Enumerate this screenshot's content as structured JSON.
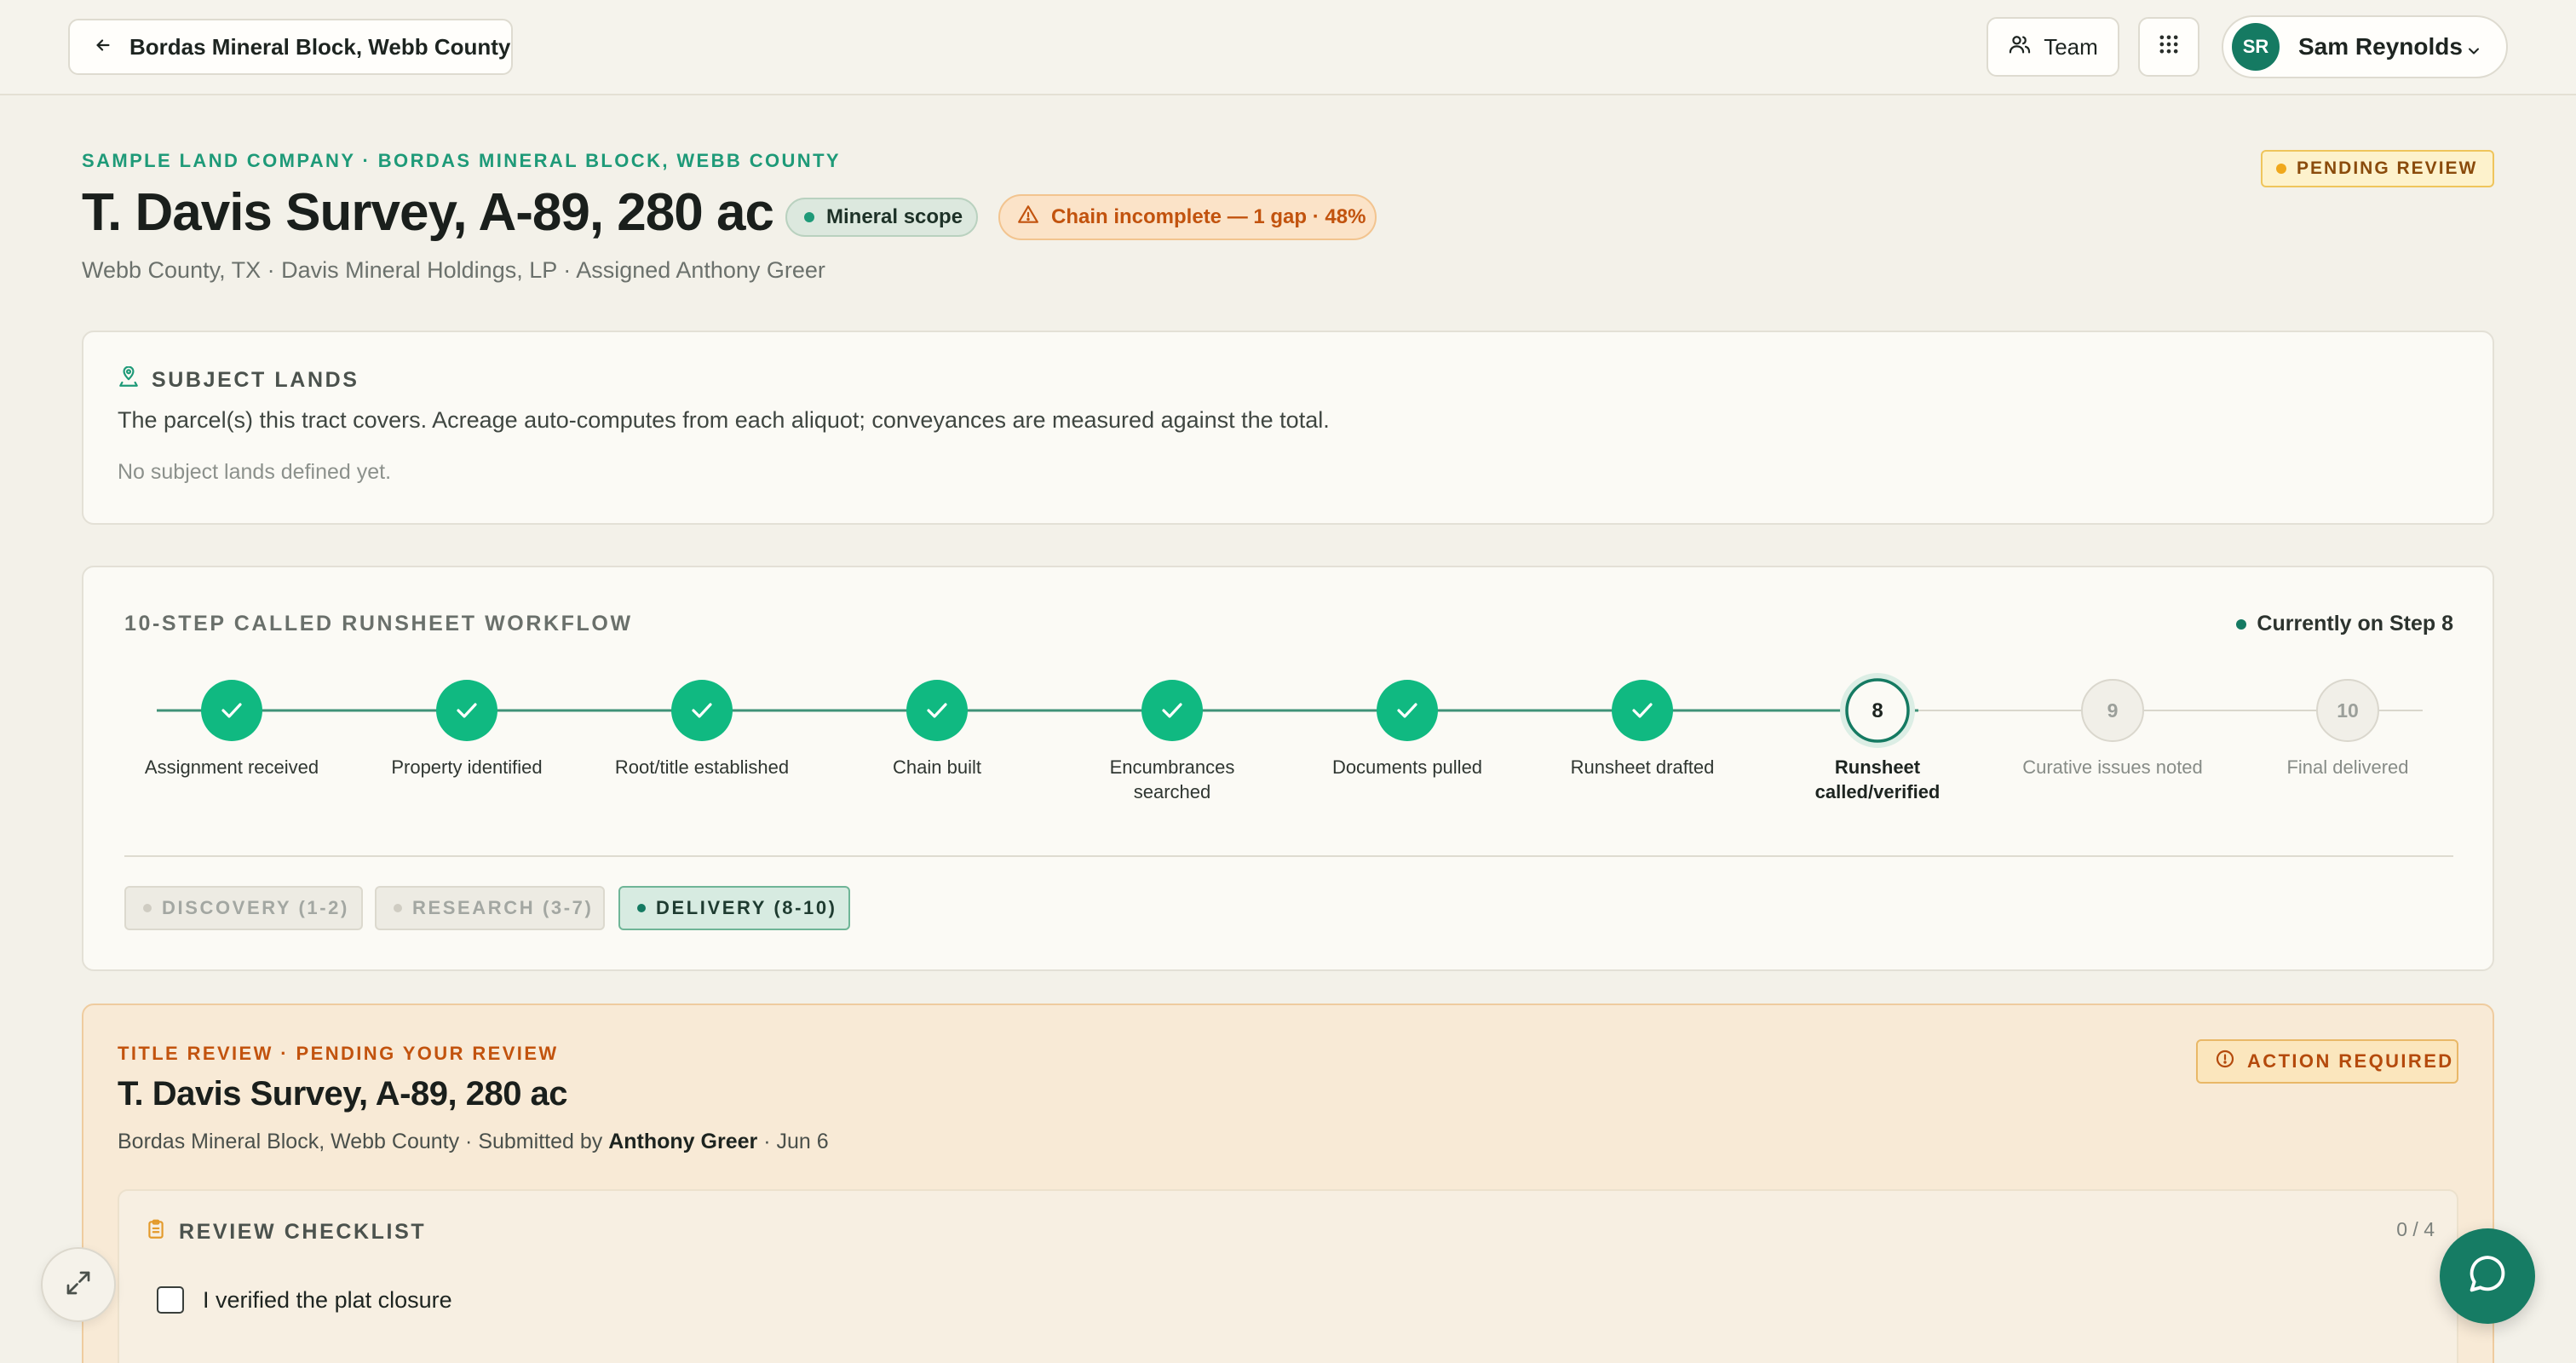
{
  "topbar": {
    "back_label": "Bordas Mineral Block, Webb County",
    "team_label": "Team",
    "user": {
      "initials": "SR",
      "name": "Sam Reynolds"
    }
  },
  "header": {
    "eyebrow": "SAMPLE LAND COMPANY · BORDAS MINERAL BLOCK, WEBB COUNTY",
    "title": "T. Davis Survey, A-89, 280 ac",
    "scope_badge": "Mineral scope",
    "chain_badge": "Chain incomplete — 1 gap · 48%",
    "subtitle": "Webb County, TX · Davis Mineral Holdings, LP · Assigned Anthony Greer",
    "status_badge": "PENDING REVIEW"
  },
  "subject_lands": {
    "heading": "SUBJECT LANDS",
    "description": "The parcel(s) this tract covers. Acreage auto-computes from each aliquot; conveyances are measured against the total.",
    "empty_text": "No subject lands defined yet."
  },
  "workflow": {
    "heading": "10-STEP CALLED RUNSHEET WORKFLOW",
    "current_text": "Currently on Step 8",
    "current_step": 8,
    "steps": [
      {
        "label": "Assignment received",
        "status": "done"
      },
      {
        "label": "Property identified",
        "status": "done"
      },
      {
        "label": "Root/title established",
        "status": "done"
      },
      {
        "label": "Chain built",
        "status": "done"
      },
      {
        "label": "Encumbrances searched",
        "status": "done"
      },
      {
        "label": "Documents pulled",
        "status": "done"
      },
      {
        "label": "Runsheet drafted",
        "status": "done"
      },
      {
        "label": "Runsheet called/verified",
        "status": "current"
      },
      {
        "label": "Curative issues noted",
        "status": "future"
      },
      {
        "label": "Final delivered",
        "status": "future"
      }
    ],
    "phases": [
      {
        "label": "DISCOVERY (1-2)",
        "active": false
      },
      {
        "label": "RESEARCH (3-7)",
        "active": false
      },
      {
        "label": "DELIVERY (8-10)",
        "active": true
      }
    ]
  },
  "review": {
    "eyebrow": "TITLE REVIEW · PENDING YOUR REVIEW",
    "title": "T. Davis Survey, A-89, 280 ac",
    "sub_prefix": "Bordas Mineral Block, Webb County · Submitted by",
    "submitter": "Anthony Greer",
    "sub_suffix": "· Jun 6",
    "action_badge": "ACTION REQUIRED",
    "checklist": {
      "heading": "REVIEW CHECKLIST",
      "count": "0 / 4",
      "items": [
        {
          "label": "I verified the plat closure",
          "checked": false
        }
      ]
    }
  },
  "colors": {
    "accent_green": "#1e9a78",
    "step_done": "#10b981",
    "step_current_ring": "#157a62",
    "warning_orange": "#c2530e",
    "pending_yellow": "#efc55c"
  },
  "icons": {
    "back": "arrow-left-icon",
    "team": "users-icon",
    "apps": "grid-icon",
    "user_menu": "chevron-down-icon",
    "chain_badge": "warning-triangle-icon",
    "subject_lands": "map-pin-icon",
    "step_done": "check-icon",
    "action": "alert-circle-icon",
    "checklist": "clipboard-icon",
    "expand": "expand-icon",
    "chat": "chat-bubble-icon"
  }
}
